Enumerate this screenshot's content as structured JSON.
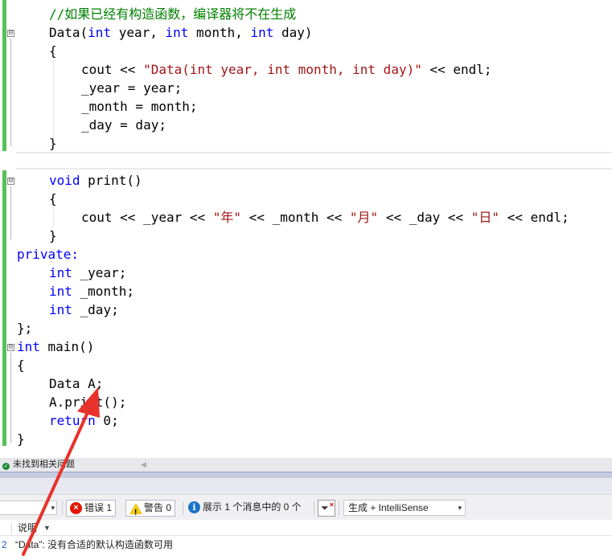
{
  "editor": {
    "code": {
      "l1": [
        "//如果已经有构造函数，编译器将不在生成"
      ],
      "l2": [
        "Data(",
        "int",
        " year, ",
        "int",
        " month, ",
        "int",
        " day)"
      ],
      "l3": [
        "{"
      ],
      "l4": [
        "cout << ",
        "\"Data(int year, int month, int day)\"",
        " << endl;"
      ],
      "l5": [
        "_year = year;"
      ],
      "l6": [
        "_month = month;"
      ],
      "l7": [
        "_day = day;"
      ],
      "l8": [
        "}"
      ],
      "l10": [
        "void",
        " print()"
      ],
      "l11": [
        "{"
      ],
      "l12": [
        "cout << _year << ",
        "\"年\"",
        " << _month << ",
        "\"月\"",
        " << _day << ",
        "\"日\"",
        " << endl;"
      ],
      "l13": [
        "}"
      ],
      "l14": [
        "private:"
      ],
      "l15": [
        "int",
        " _year;"
      ],
      "l16": [
        "int",
        " _month;"
      ],
      "l17": [
        "int",
        " _day;"
      ],
      "l18": [
        "};"
      ],
      "l19": [
        "int",
        " main()"
      ],
      "l20": [
        "{"
      ],
      "l21": [
        "Data A;"
      ],
      "l22": [
        "A.print();"
      ],
      "l23": [
        "return",
        " 0;"
      ],
      "l24": [
        "}"
      ]
    },
    "fold_symbol": "⊟"
  },
  "status": {
    "ok_icon": "check-circle-icon",
    "message": "未找到相关问题",
    "scroll_left": "◀"
  },
  "toolbar": {
    "errors_label": "错误 1",
    "warnings_label": "警告 0",
    "messages_label": "展示 1 个消息中的 0 个",
    "build_filter": "生成 + IntelliSense",
    "dropdown_glyph": "▾",
    "error_icon_glyph": "×",
    "warn_icon_glyph": "!",
    "info_icon_glyph": "i"
  },
  "error_list": {
    "column_description": "说明",
    "sort_glyph": "▼",
    "rows": [
      {
        "index": "2",
        "description": "“Data”: 没有合适的默认构造函数可用"
      }
    ]
  },
  "colors": {
    "keyword": "#0000ff",
    "string": "#a31515",
    "comment": "#008000",
    "change_bar": "#57c157",
    "panel_accent": "#9aa1c4",
    "annotation_arrow": "#e8322c"
  }
}
